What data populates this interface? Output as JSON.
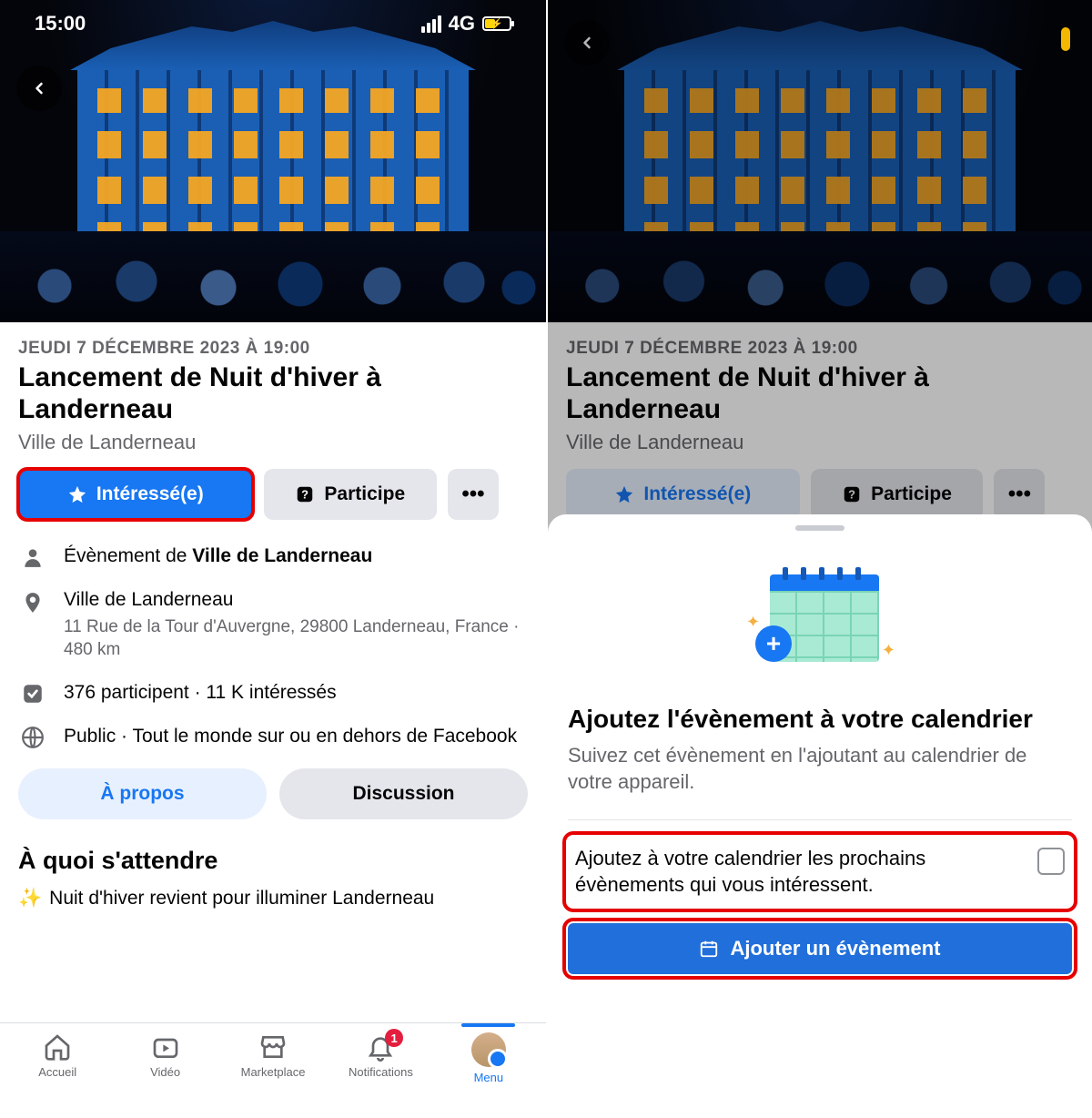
{
  "status": {
    "time": "15:00",
    "network": "4G"
  },
  "event": {
    "date_line": "JEUDI 7 DÉCEMBRE 2023 À 19:00",
    "title": "Lancement de Nuit d'hiver à Landerneau",
    "organizer": "Ville de Landerneau"
  },
  "actions": {
    "interested": "Intéressé(e)",
    "going": "Participe",
    "more": "•••"
  },
  "details": {
    "by_prefix": "Évènement de ",
    "by_name": "Ville de Landerneau",
    "place": "Ville de Landerneau",
    "address": "11 Rue de la Tour d'Auvergne, 29800 Landerneau, France · 480 km",
    "attendance": "376 participent · 11 K intéressés",
    "privacy": "Public · Tout le monde sur ou en dehors de Facebook"
  },
  "tabs": {
    "about": "À propos",
    "discussion": "Discussion"
  },
  "expect": {
    "heading": "À quoi s'attendre",
    "line": "Nuit d'hiver revient pour illuminer Landerneau"
  },
  "nav": {
    "home": "Accueil",
    "video": "Vidéo",
    "marketplace": "Marketplace",
    "notifications": "Notifications",
    "notifications_badge": "1",
    "menu": "Menu"
  },
  "sheet": {
    "title": "Ajoutez l'évènement à votre calendrier",
    "subtitle": "Suivez cet évènement en l'ajoutant au calendrier de votre appareil.",
    "checkbox_label": "Ajoutez à votre calendrier les prochains évènements qui vous intéressent.",
    "add_button": "Ajouter un évènement"
  }
}
